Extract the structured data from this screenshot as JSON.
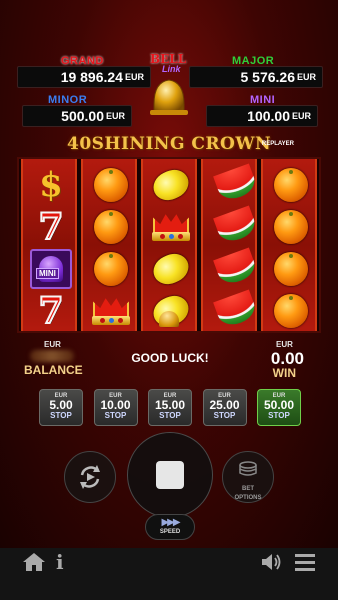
{
  "jackpots": {
    "grand": {
      "label": "GRAND",
      "value": "19 896.24",
      "currency": "EUR",
      "color": "#e8141b"
    },
    "major": {
      "label": "MAJOR",
      "value": "5 576.26",
      "currency": "EUR",
      "color": "#2fcf3a"
    },
    "minor": {
      "label": "MINOR",
      "value": "500.00",
      "currency": "EUR",
      "color": "#3a7ef0"
    },
    "mini": {
      "label": "MINI",
      "value": "100.00",
      "currency": "EUR",
      "color": "#b264ff"
    }
  },
  "logo": {
    "line1": "BELL",
    "line2": "Link"
  },
  "game": {
    "title": "40SHINING CROWN",
    "replayer": "REPLAYER"
  },
  "reels": [
    [
      "dollar",
      "seven",
      "bell-mini",
      "seven"
    ],
    [
      "orange",
      "orange",
      "orange",
      "crown"
    ],
    [
      "lemon",
      "crown",
      "lemon",
      "lemon"
    ],
    [
      "melon",
      "melon",
      "melon",
      "melon"
    ],
    [
      "orange",
      "orange",
      "orange",
      "orange"
    ]
  ],
  "mini_tag": "MINI",
  "info": {
    "balance_currency": "EUR",
    "balance_label": "BALANCE",
    "message": "GOOD LUCK!",
    "win_currency": "EUR",
    "win_value": "0.00",
    "win_label": "WIN"
  },
  "stops": [
    {
      "currency": "EUR",
      "amount": "5.00",
      "label": "STOP",
      "active": false
    },
    {
      "currency": "EUR",
      "amount": "10.00",
      "label": "STOP",
      "active": false
    },
    {
      "currency": "EUR",
      "amount": "15.00",
      "label": "STOP",
      "active": false
    },
    {
      "currency": "EUR",
      "amount": "25.00",
      "label": "STOP",
      "active": false
    },
    {
      "currency": "EUR",
      "amount": "50.00",
      "label": "STOP",
      "active": true
    }
  ],
  "controls": {
    "bet_label_1": "BET",
    "bet_label_2": "OPTIONS",
    "speed_arrows": "▶▶▶",
    "speed_label": "SPEED"
  },
  "bottom_bar": {
    "icons": [
      "home-icon",
      "info-icon",
      "volume-icon",
      "menu-icon"
    ],
    "info_glyph": "i"
  }
}
